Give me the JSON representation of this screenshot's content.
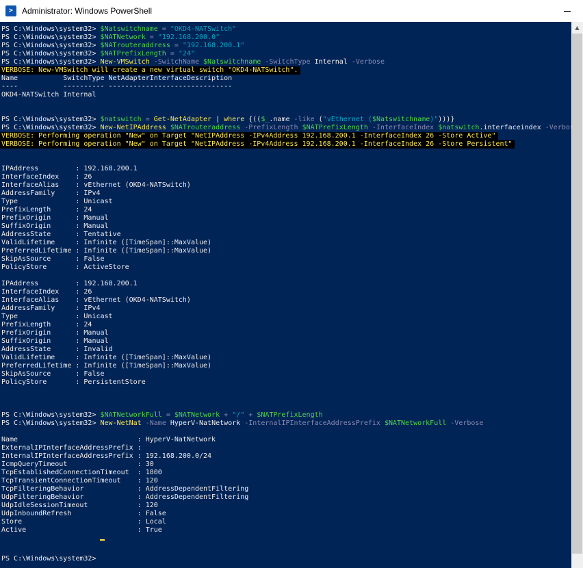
{
  "window": {
    "title": "Administrator: Windows PowerShell"
  },
  "prompt": "PS C:\\Windows\\system32> ",
  "lines": [
    {
      "t": 5,
      "bg": "",
      "segs": [
        {
          "c": "c-prompt",
          "t": "PS C:\\Windows\\system32> "
        },
        {
          "c": "c-var",
          "t": "$Natswitchname"
        },
        {
          "c": "c-op",
          "t": " = "
        },
        {
          "c": "c-str",
          "t": "\"OKD4-NATSwitch\""
        }
      ]
    },
    {
      "t": 17,
      "bg": "",
      "segs": [
        {
          "c": "c-prompt",
          "t": "PS C:\\Windows\\system32> "
        },
        {
          "c": "c-var",
          "t": "$NATNetwork"
        },
        {
          "c": "c-op",
          "t": " = "
        },
        {
          "c": "c-str",
          "t": "\"192.168.200.0\""
        }
      ]
    },
    {
      "t": 29,
      "bg": "",
      "segs": [
        {
          "c": "c-prompt",
          "t": "PS C:\\Windows\\system32> "
        },
        {
          "c": "c-var",
          "t": "$NATrouteraddress"
        },
        {
          "c": "c-op",
          "t": " = "
        },
        {
          "c": "c-str",
          "t": "\"192.168.200.1\""
        }
      ]
    },
    {
      "t": 41,
      "bg": "",
      "segs": [
        {
          "c": "c-prompt",
          "t": "PS C:\\Windows\\system32> "
        },
        {
          "c": "c-var",
          "t": "$NATPrefixLength"
        },
        {
          "c": "c-op",
          "t": " = "
        },
        {
          "c": "c-str",
          "t": "\"24\""
        }
      ]
    },
    {
      "t": 53,
      "bg": "",
      "segs": [
        {
          "c": "c-prompt",
          "t": "PS C:\\Windows\\system32> "
        },
        {
          "c": "c-cmd",
          "t": "New-VMSwitch"
        },
        {
          "c": "c-param",
          "t": " -SwitchName "
        },
        {
          "c": "c-var",
          "t": "$Natswitchname"
        },
        {
          "c": "c-param",
          "t": " -SwitchType "
        },
        {
          "c": "c-text",
          "t": "Internal"
        },
        {
          "c": "c-param",
          "t": " -Verbose"
        }
      ]
    },
    {
      "t": 65,
      "bg": "black",
      "segs": [
        {
          "c": "c-verbose",
          "t": "VERBOSE: New-VMSwitch will create a new virtual switch \"OKD4-NATSwitch\"."
        }
      ]
    },
    {
      "t": 77,
      "bg": "",
      "segs": [
        {
          "c": "c-text",
          "t": "Name           SwitchType NetAdapterInterfaceDescription"
        }
      ]
    },
    {
      "t": 89,
      "bg": "",
      "segs": [
        {
          "c": "c-text",
          "t": "----           ---------- ------------------------------"
        }
      ]
    },
    {
      "t": 101,
      "bg": "",
      "segs": [
        {
          "c": "c-text",
          "t": "OKD4-NATSwitch Internal"
        }
      ]
    },
    {
      "t": 137,
      "bg": "",
      "segs": [
        {
          "c": "c-prompt",
          "t": "PS C:\\Windows\\system32> "
        },
        {
          "c": "c-var",
          "t": "$natswitch"
        },
        {
          "c": "c-op",
          "t": " = "
        },
        {
          "c": "c-cmd",
          "t": "Get-NetAdapter"
        },
        {
          "c": "c-text",
          "t": " | "
        },
        {
          "c": "c-cmd",
          "t": "where"
        },
        {
          "c": "c-text",
          "t": " {(("
        },
        {
          "c": "c-var",
          "t": "$_"
        },
        {
          "c": "c-text",
          "t": ".name "
        },
        {
          "c": "c-param",
          "t": "-like"
        },
        {
          "c": "c-text",
          "t": " ("
        },
        {
          "c": "c-str",
          "t": "\"vEthernet ("
        },
        {
          "c": "c-var",
          "t": "$Natswitchname"
        },
        {
          "c": "c-str",
          "t": ")\""
        },
        {
          "c": "c-text",
          "t": ")))}"
        }
      ]
    },
    {
      "t": 149,
      "bg": "",
      "segs": [
        {
          "c": "c-prompt",
          "t": "PS C:\\Windows\\system32> "
        },
        {
          "c": "c-cmd",
          "t": "New-NetIPAddress"
        },
        {
          "c": "c-text",
          "t": " "
        },
        {
          "c": "c-var",
          "t": "$NATrouteraddress"
        },
        {
          "c": "c-param",
          "t": " -PrefixLength "
        },
        {
          "c": "c-var",
          "t": "$NATPrefixLength"
        },
        {
          "c": "c-param",
          "t": " -InterfaceIndex "
        },
        {
          "c": "c-var",
          "t": "$natswitch"
        },
        {
          "c": "c-text",
          "t": ".interfaceindex"
        },
        {
          "c": "c-param",
          "t": " -Verbose"
        }
      ]
    },
    {
      "t": 161,
      "bg": "black",
      "segs": [
        {
          "c": "c-verbose",
          "t": "VERBOSE: Performing operation \"New\" on Target \"NetIPAddress -IPv4Address 192.168.200.1 -InterfaceIndex 26 -Store Active\""
        }
      ]
    },
    {
      "t": 173,
      "bg": "black",
      "segs": [
        {
          "c": "c-verbose",
          "t": "VERBOSE: Performing operation \"New\" on Target \"NetIPAddress -IPv4Address 192.168.200.1 -InterfaceIndex 26 -Store Persistent\""
        }
      ]
    },
    {
      "t": 209,
      "bg": "",
      "segs": [
        {
          "c": "c-text",
          "t": "IPAddress         : 192.168.200.1"
        }
      ]
    },
    {
      "t": 221,
      "bg": "",
      "segs": [
        {
          "c": "c-text",
          "t": "InterfaceIndex    : 26"
        }
      ]
    },
    {
      "t": 233,
      "bg": "",
      "segs": [
        {
          "c": "c-text",
          "t": "InterfaceAlias    : vEthernet (OKD4-NATSwitch)"
        }
      ]
    },
    {
      "t": 245,
      "bg": "",
      "segs": [
        {
          "c": "c-text",
          "t": "AddressFamily     : IPv4"
        }
      ]
    },
    {
      "t": 257,
      "bg": "",
      "segs": [
        {
          "c": "c-text",
          "t": "Type              : Unicast"
        }
      ]
    },
    {
      "t": 269,
      "bg": "",
      "segs": [
        {
          "c": "c-text",
          "t": "PrefixLength      : 24"
        }
      ]
    },
    {
      "t": 281,
      "bg": "",
      "segs": [
        {
          "c": "c-text",
          "t": "PrefixOrigin      : Manual"
        }
      ]
    },
    {
      "t": 293,
      "bg": "",
      "segs": [
        {
          "c": "c-text",
          "t": "SuffixOrigin      : Manual"
        }
      ]
    },
    {
      "t": 305,
      "bg": "",
      "segs": [
        {
          "c": "c-text",
          "t": "AddressState      : Tentative"
        }
      ]
    },
    {
      "t": 317,
      "bg": "",
      "segs": [
        {
          "c": "c-text",
          "t": "ValidLifetime     : Infinite ([TimeSpan]::MaxValue)"
        }
      ]
    },
    {
      "t": 329,
      "bg": "",
      "segs": [
        {
          "c": "c-text",
          "t": "PreferredLifetime : Infinite ([TimeSpan]::MaxValue)"
        }
      ]
    },
    {
      "t": 341,
      "bg": "",
      "segs": [
        {
          "c": "c-text",
          "t": "SkipAsSource      : False"
        }
      ]
    },
    {
      "t": 353,
      "bg": "",
      "segs": [
        {
          "c": "c-text",
          "t": "PolicyStore       : ActiveStore"
        }
      ]
    },
    {
      "t": 377,
      "bg": "",
      "segs": [
        {
          "c": "c-text",
          "t": "IPAddress         : 192.168.200.1"
        }
      ]
    },
    {
      "t": 389,
      "bg": "",
      "segs": [
        {
          "c": "c-text",
          "t": "InterfaceIndex    : 26"
        }
      ]
    },
    {
      "t": 401,
      "bg": "",
      "segs": [
        {
          "c": "c-text",
          "t": "InterfaceAlias    : vEthernet (OKD4-NATSwitch)"
        }
      ]
    },
    {
      "t": 413,
      "bg": "",
      "segs": [
        {
          "c": "c-text",
          "t": "AddressFamily     : IPv4"
        }
      ]
    },
    {
      "t": 425,
      "bg": "",
      "segs": [
        {
          "c": "c-text",
          "t": "Type              : Unicast"
        }
      ]
    },
    {
      "t": 437,
      "bg": "",
      "segs": [
        {
          "c": "c-text",
          "t": "PrefixLength      : 24"
        }
      ]
    },
    {
      "t": 449,
      "bg": "",
      "segs": [
        {
          "c": "c-text",
          "t": "PrefixOrigin      : Manual"
        }
      ]
    },
    {
      "t": 461,
      "bg": "",
      "segs": [
        {
          "c": "c-text",
          "t": "SuffixOrigin      : Manual"
        }
      ]
    },
    {
      "t": 473,
      "bg": "",
      "segs": [
        {
          "c": "c-text",
          "t": "AddressState      : Invalid"
        }
      ]
    },
    {
      "t": 485,
      "bg": "",
      "segs": [
        {
          "c": "c-text",
          "t": "ValidLifetime     : Infinite ([TimeSpan]::MaxValue)"
        }
      ]
    },
    {
      "t": 497,
      "bg": "",
      "segs": [
        {
          "c": "c-text",
          "t": "PreferredLifetime : Infinite ([TimeSpan]::MaxValue)"
        }
      ]
    },
    {
      "t": 509,
      "bg": "",
      "segs": [
        {
          "c": "c-text",
          "t": "SkipAsSource      : False"
        }
      ]
    },
    {
      "t": 521,
      "bg": "",
      "segs": [
        {
          "c": "c-text",
          "t": "PolicyStore       : PersistentStore"
        }
      ]
    },
    {
      "t": 569,
      "bg": "",
      "segs": [
        {
          "c": "c-prompt",
          "t": "PS C:\\Windows\\system32> "
        },
        {
          "c": "c-var",
          "t": "$NATNetworkFull"
        },
        {
          "c": "c-op",
          "t": " = "
        },
        {
          "c": "c-var",
          "t": "$NATNetwork"
        },
        {
          "c": "c-op",
          "t": " + "
        },
        {
          "c": "c-str",
          "t": "\"/\""
        },
        {
          "c": "c-op",
          "t": " + "
        },
        {
          "c": "c-var",
          "t": "$NATPrefixLength"
        }
      ]
    },
    {
      "t": 581,
      "bg": "",
      "segs": [
        {
          "c": "c-prompt",
          "t": "PS C:\\Windows\\system32> "
        },
        {
          "c": "c-cmd",
          "t": "New-NetNat"
        },
        {
          "c": "c-param",
          "t": " -Name "
        },
        {
          "c": "c-text",
          "t": "HyperV-NatNetwork"
        },
        {
          "c": "c-param",
          "t": " -InternalIPInterfaceAddressPrefix "
        },
        {
          "c": "c-var",
          "t": "$NATNetworkFull"
        },
        {
          "c": "c-param",
          "t": " -Verbose"
        }
      ]
    },
    {
      "t": 605,
      "bg": "",
      "segs": [
        {
          "c": "c-text",
          "t": "Name                             : HyperV-NatNetwork"
        }
      ]
    },
    {
      "t": 617,
      "bg": "",
      "segs": [
        {
          "c": "c-text",
          "t": "ExternalIPInterfaceAddressPrefix :"
        }
      ]
    },
    {
      "t": 629,
      "bg": "",
      "segs": [
        {
          "c": "c-text",
          "t": "InternalIPInterfaceAddressPrefix : 192.168.200.0/24"
        }
      ]
    },
    {
      "t": 641,
      "bg": "",
      "segs": [
        {
          "c": "c-text",
          "t": "IcmpQueryTimeout                 : 30"
        }
      ]
    },
    {
      "t": 653,
      "bg": "",
      "segs": [
        {
          "c": "c-text",
          "t": "TcpEstablishedConnectionTimeout  : 1800"
        }
      ]
    },
    {
      "t": 665,
      "bg": "",
      "segs": [
        {
          "c": "c-text",
          "t": "TcpTransientConnectionTimeout    : 120"
        }
      ]
    },
    {
      "t": 677,
      "bg": "",
      "segs": [
        {
          "c": "c-text",
          "t": "TcpFilteringBehavior             : AddressDependentFiltering"
        }
      ]
    },
    {
      "t": 689,
      "bg": "",
      "segs": [
        {
          "c": "c-text",
          "t": "UdpFilteringBehavior             : AddressDependentFiltering"
        }
      ]
    },
    {
      "t": 701,
      "bg": "",
      "segs": [
        {
          "c": "c-text",
          "t": "UdpIdleSessionTimeout            : 120"
        }
      ]
    },
    {
      "t": 713,
      "bg": "",
      "segs": [
        {
          "c": "c-text",
          "t": "UdpInboundRefresh                : False"
        }
      ]
    },
    {
      "t": 725,
      "bg": "",
      "segs": [
        {
          "c": "c-text",
          "t": "Store                            : Local"
        }
      ]
    },
    {
      "t": 737,
      "bg": "",
      "segs": [
        {
          "c": "c-text",
          "t": "Active                           : True"
        }
      ]
    },
    {
      "t": 779,
      "bg": "",
      "segs": [
        {
          "c": "c-prompt",
          "t": "PS C:\\Windows\\system32> "
        }
      ]
    }
  ]
}
